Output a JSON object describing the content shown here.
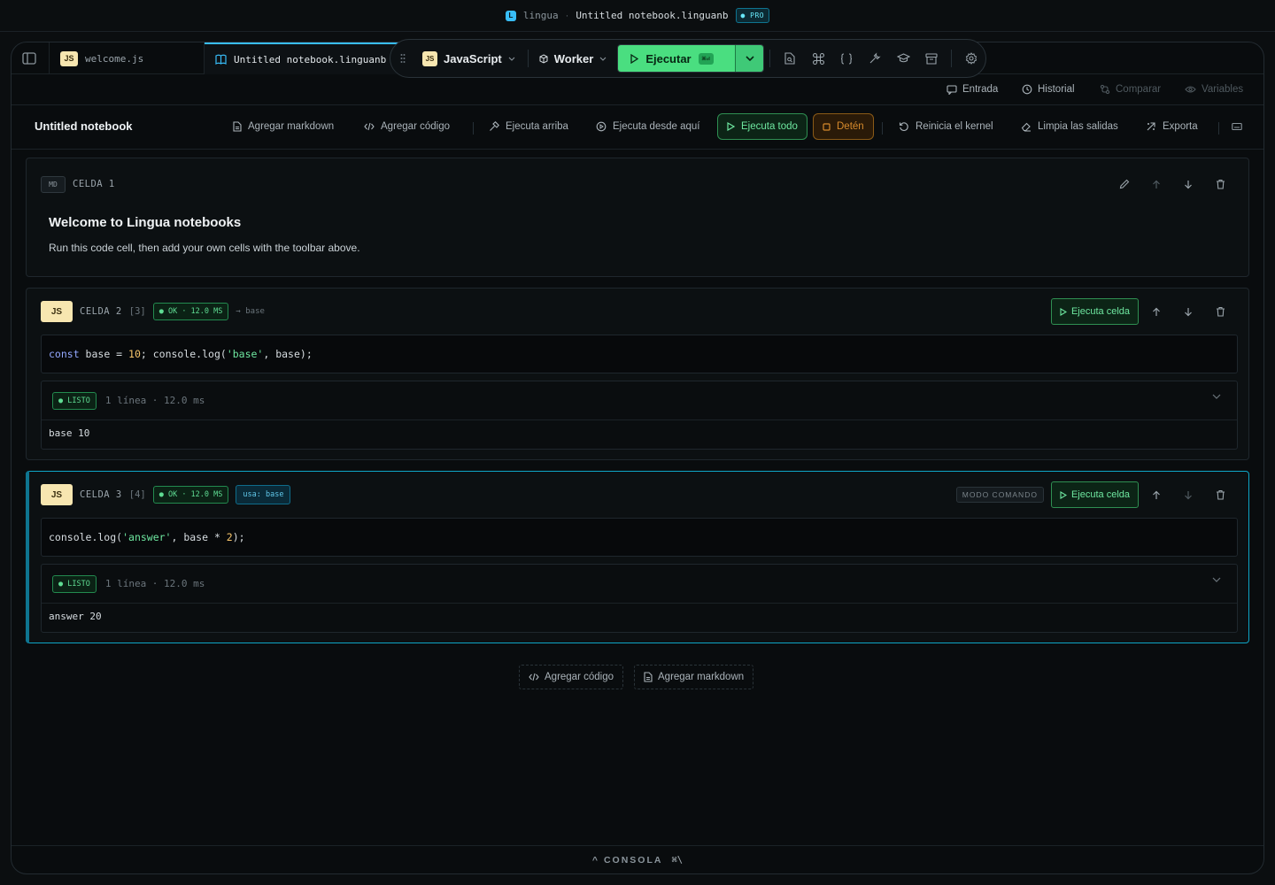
{
  "titlebar": {
    "logo_letter": "L",
    "app": "lingua",
    "separator": "·",
    "file": "Untitled notebook.linguanb",
    "plan": "● PRO"
  },
  "tabs": [
    {
      "badge": "JS",
      "label": "welcome.js"
    },
    {
      "label": "Untitled notebook.linguanb"
    }
  ],
  "toolbar": {
    "language": "JavaScript",
    "language_badge": "JS",
    "runtime": "Worker",
    "run_label": "Ejecutar",
    "run_shortcut": "⌘⏎"
  },
  "panels": [
    {
      "label": "Entrada",
      "icon": "message-icon"
    },
    {
      "label": "Historial",
      "icon": "history-icon"
    },
    {
      "label": "Comparar",
      "icon": "compare-icon"
    },
    {
      "label": "Variables",
      "icon": "eye-icon"
    }
  ],
  "notebook": {
    "title": "Untitled notebook",
    "actions": {
      "add_markdown": "Agregar markdown",
      "add_code": "Agregar código",
      "run_above": "Ejecuta arriba",
      "run_from_here": "Ejecuta desde aquí",
      "run_all": "Ejecuta todo",
      "stop": "Detén",
      "restart_kernel": "Reinicia el kernel",
      "clear_outputs": "Limpia las salidas",
      "export": "Exporta"
    }
  },
  "cells": [
    {
      "type_badge": "MD",
      "label": "CELDA 1",
      "heading": "Welcome to Lingua notebooks",
      "body": "Run this code cell, then add your own cells with the toolbar above."
    },
    {
      "type_badge": "JS",
      "label": "CELDA 2",
      "exec_count": "[3]",
      "status": "● OK · 12.0 MS",
      "defines": "→ base",
      "run_label": "Ejecuta celda",
      "code": {
        "t1": "const",
        "t2": " base = ",
        "t3": "10",
        "t4": "; console.log(",
        "t5": "'base'",
        "t6": ", base);"
      },
      "output": {
        "state": "● LISTO",
        "meta": "1 línea · 12.0 ms",
        "text": "base 10"
      }
    },
    {
      "type_badge": "JS",
      "label": "CELDA 3",
      "exec_count": "[4]",
      "status": "● OK · 12.0 MS",
      "uses": "usa: base",
      "mode": "MODO COMANDO",
      "run_label": "Ejecuta celda",
      "code": {
        "t1": "console.log(",
        "t2": "'answer'",
        "t3": ", base * ",
        "t4": "2",
        "t5": ");"
      },
      "output": {
        "state": "● LISTO",
        "meta": "1 línea · 12.0 ms",
        "text": "answer 20"
      }
    }
  ],
  "footer": {
    "add_code": "Agregar código",
    "add_markdown": "Agregar markdown"
  },
  "console": {
    "label": "^ CONSOLA",
    "shortcut": "⌘\\"
  },
  "colors": {
    "accent": "#38bdf8",
    "run": "#4ade80",
    "stop": "#d68a2c",
    "active_cell": "#0ea5c6"
  }
}
